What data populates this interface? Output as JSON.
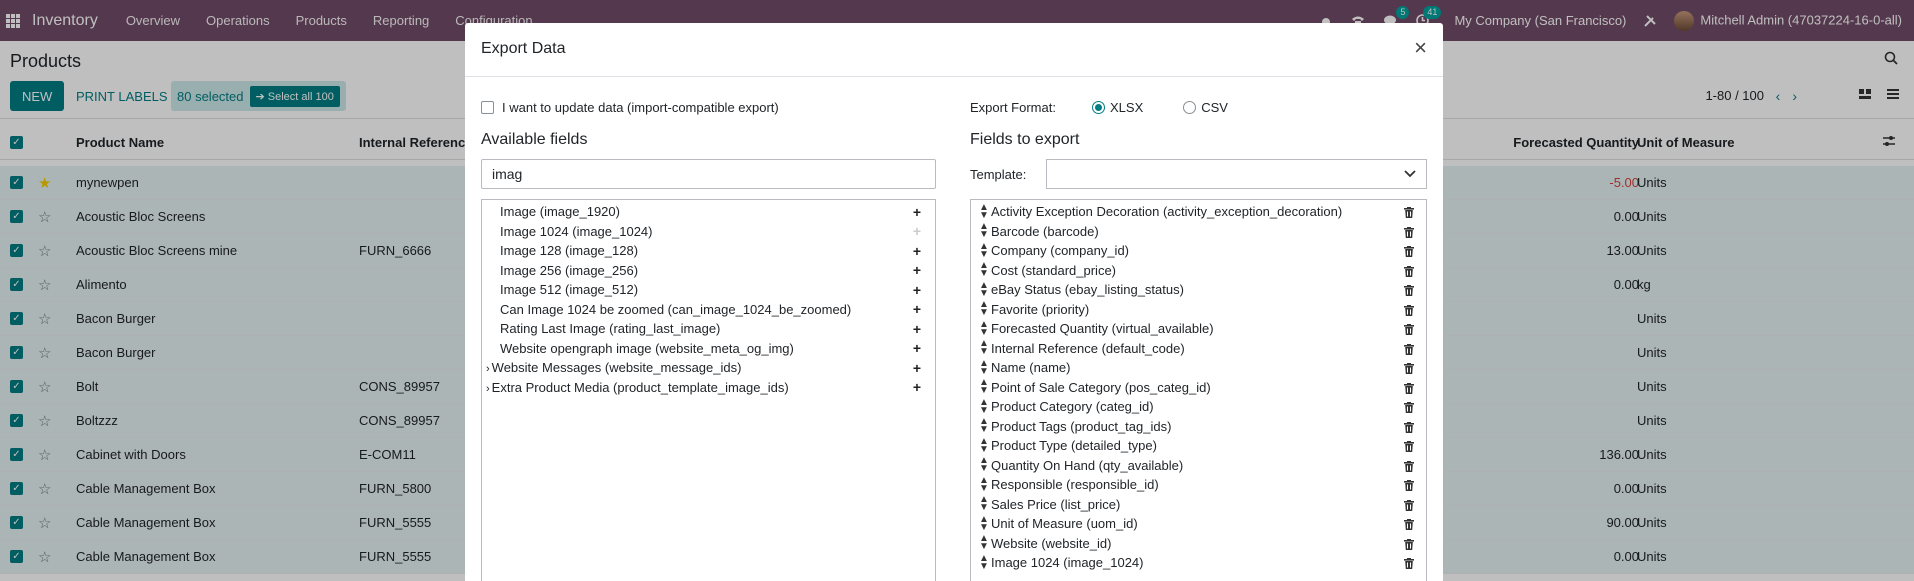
{
  "navbar": {
    "app_name": "Inventory",
    "menus": [
      "Overview",
      "Operations",
      "Products",
      "Reporting",
      "Configuration"
    ],
    "messages_count": "5",
    "activities_count": "41",
    "company": "My Company (San Francisco)",
    "user": "Mitchell Admin (47037224-16-0-all)"
  },
  "control_panel": {
    "breadcrumb": "Products",
    "new_label": "NEW",
    "print_label": "PRINT LABELS",
    "selected_label": "80 selected",
    "select_all_label": "➔ Select all 100",
    "pager": "1-80 / 100"
  },
  "list": {
    "columns": {
      "name": "Product Name",
      "ref": "Internal Reference",
      "forecast": "Forecasted Quantity",
      "uom": "Unit of Measure"
    },
    "rows": [
      {
        "name": "mynewpen",
        "ref": "",
        "fq": "-5.00",
        "uom": "Units",
        "fav": true
      },
      {
        "name": "Acoustic Bloc Screens",
        "ref": "",
        "fq": "0.00",
        "uom": "Units",
        "fav": false
      },
      {
        "name": "Acoustic Bloc Screens mine",
        "ref": "FURN_6666",
        "fq": "13.00",
        "uom": "Units",
        "fav": false
      },
      {
        "name": "Alimento",
        "ref": "",
        "fq": "0.00",
        "uom": "kg",
        "fav": false
      },
      {
        "name": "Bacon Burger",
        "ref": "",
        "fq": "",
        "uom": "Units",
        "fav": false
      },
      {
        "name": "Bacon Burger",
        "ref": "",
        "fq": "",
        "uom": "Units",
        "fav": false
      },
      {
        "name": "Bolt",
        "ref": "CONS_89957",
        "fq": "",
        "uom": "Units",
        "fav": false
      },
      {
        "name": "Boltzzz",
        "ref": "CONS_89957",
        "fq": "",
        "uom": "Units",
        "fav": false
      },
      {
        "name": "Cabinet with Doors",
        "ref": "E-COM11",
        "fq": "136.00",
        "uom": "Units",
        "fav": false
      },
      {
        "name": "Cable Management Box",
        "ref": "FURN_5800",
        "fq": "0.00",
        "uom": "Units",
        "fav": false
      },
      {
        "name": "Cable Management Box",
        "ref": "FURN_5555",
        "fq": "90.00",
        "uom": "Units",
        "fav": false
      },
      {
        "name": "Cable Management Box",
        "ref": "FURN_5555",
        "fq": "0.00",
        "uom": "Units",
        "fav": false
      }
    ]
  },
  "dialog": {
    "title": "Export Data",
    "import_compat_label": "I want to update data (import-compatible export)",
    "available_title": "Available fields",
    "search_value": "imag",
    "available_fields": [
      {
        "label": "Image (image_1920)",
        "expandable": false,
        "added": false
      },
      {
        "label": "Image 1024 (image_1024)",
        "expandable": false,
        "added": true
      },
      {
        "label": "Image 128 (image_128)",
        "expandable": false,
        "added": false
      },
      {
        "label": "Image 256 (image_256)",
        "expandable": false,
        "added": false
      },
      {
        "label": "Image 512 (image_512)",
        "expandable": false,
        "added": false
      },
      {
        "label": "Can Image 1024 be zoomed (can_image_1024_be_zoomed)",
        "expandable": false,
        "added": false
      },
      {
        "label": "Rating Last Image (rating_last_image)",
        "expandable": false,
        "added": false
      },
      {
        "label": "Website opengraph image (website_meta_og_img)",
        "expandable": false,
        "added": false
      },
      {
        "label": "Website Messages (website_message_ids)",
        "expandable": true,
        "added": false
      },
      {
        "label": "Extra Product Media (product_template_image_ids)",
        "expandable": true,
        "added": false
      }
    ],
    "format_label": "Export Format:",
    "formats": [
      "XLSX",
      "CSV"
    ],
    "selected_format": "XLSX",
    "export_title": "Fields to export",
    "template_label": "Template:",
    "template_value": "",
    "export_fields": [
      "Activity Exception Decoration (activity_exception_decoration)",
      "Barcode (barcode)",
      "Company (company_id)",
      "Cost (standard_price)",
      "eBay Status (ebay_listing_status)",
      "Favorite (priority)",
      "Forecasted Quantity (virtual_available)",
      "Internal Reference (default_code)",
      "Name (name)",
      "Point of Sale Category (pos_categ_id)",
      "Product Category (categ_id)",
      "Product Tags (product_tag_ids)",
      "Product Type (detailed_type)",
      "Quantity On Hand (qty_available)",
      "Responsible (responsible_id)",
      "Sales Price (list_price)",
      "Unit of Measure (uom_id)",
      "Website (website_id)",
      "Image 1024 (image_1024)"
    ]
  },
  "colors": {
    "brand": "#714b67",
    "accent": "#017e84"
  }
}
